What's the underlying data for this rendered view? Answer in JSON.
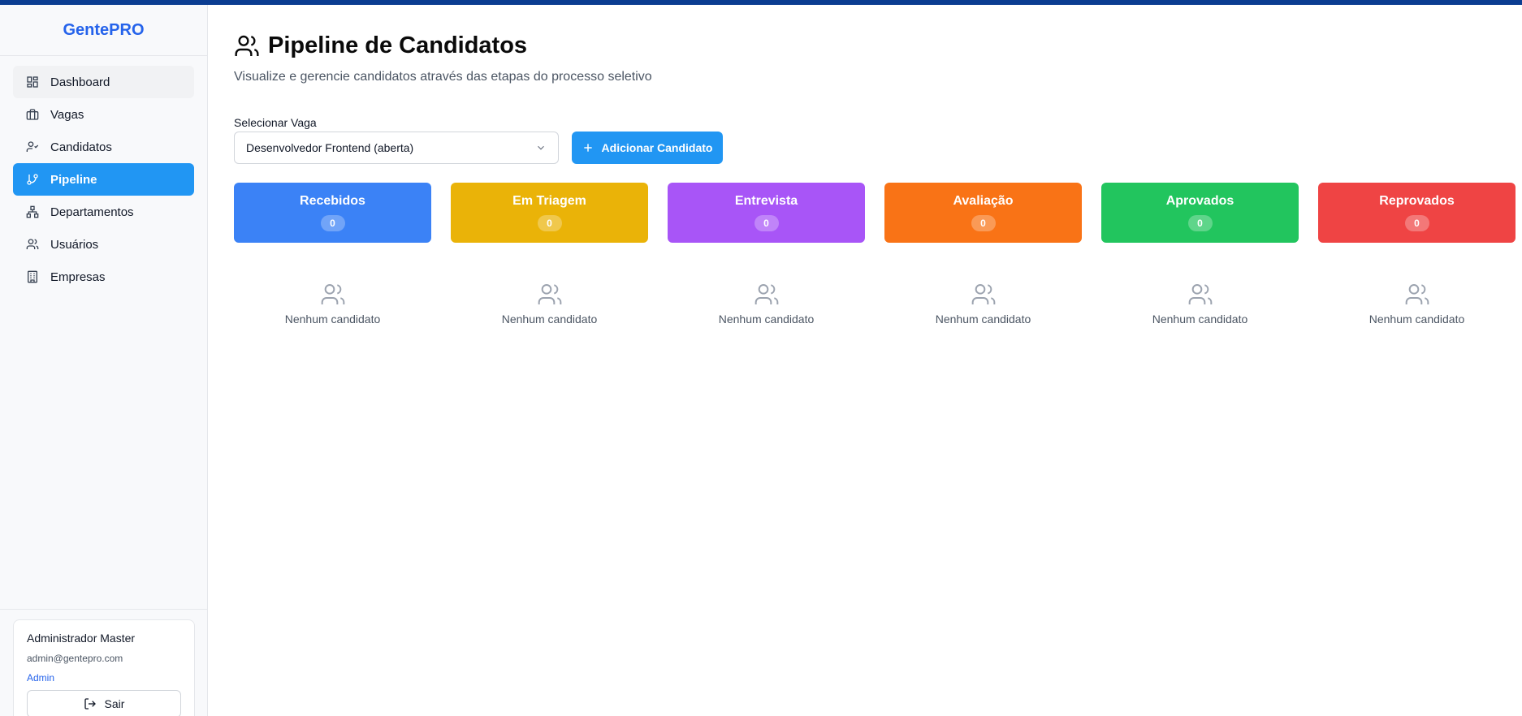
{
  "brand": "GentePRO",
  "sidebar": {
    "items": [
      {
        "label": "Dashboard",
        "icon": "dashboard-icon"
      },
      {
        "label": "Vagas",
        "icon": "briefcase-icon"
      },
      {
        "label": "Candidatos",
        "icon": "user-check-icon"
      },
      {
        "label": "Pipeline",
        "icon": "git-branch-icon"
      },
      {
        "label": "Departamentos",
        "icon": "org-chart-icon"
      },
      {
        "label": "Usuários",
        "icon": "users-icon"
      },
      {
        "label": "Empresas",
        "icon": "building-icon"
      }
    ],
    "active": "Pipeline"
  },
  "user": {
    "name": "Administrador Master",
    "email": "admin@gentepro.com",
    "role": "Admin",
    "logout_label": "Sair"
  },
  "main": {
    "title": "Pipeline de Candidatos",
    "subtitle": "Visualize e gerencie candidatos através das etapas do processo seletivo",
    "select_label": "Selecionar Vaga",
    "select_value": "Desenvolvedor Frontend (aberta)",
    "add_button": "Adicionar Candidato",
    "columns": [
      {
        "title": "Recebidos",
        "count": "0",
        "color": "#3b82f6",
        "empty": "Nenhum candidato"
      },
      {
        "title": "Em Triagem",
        "count": "0",
        "color": "#eab308",
        "empty": "Nenhum candidato"
      },
      {
        "title": "Entrevista",
        "count": "0",
        "color": "#a855f7",
        "empty": "Nenhum candidato"
      },
      {
        "title": "Avaliação",
        "count": "0",
        "color": "#f97316",
        "empty": "Nenhum candidato"
      },
      {
        "title": "Aprovados",
        "count": "0",
        "color": "#22c55e",
        "empty": "Nenhum candidato"
      },
      {
        "title": "Reprovados",
        "count": "0",
        "color": "#ef4444",
        "empty": "Nenhum candidato"
      }
    ]
  }
}
